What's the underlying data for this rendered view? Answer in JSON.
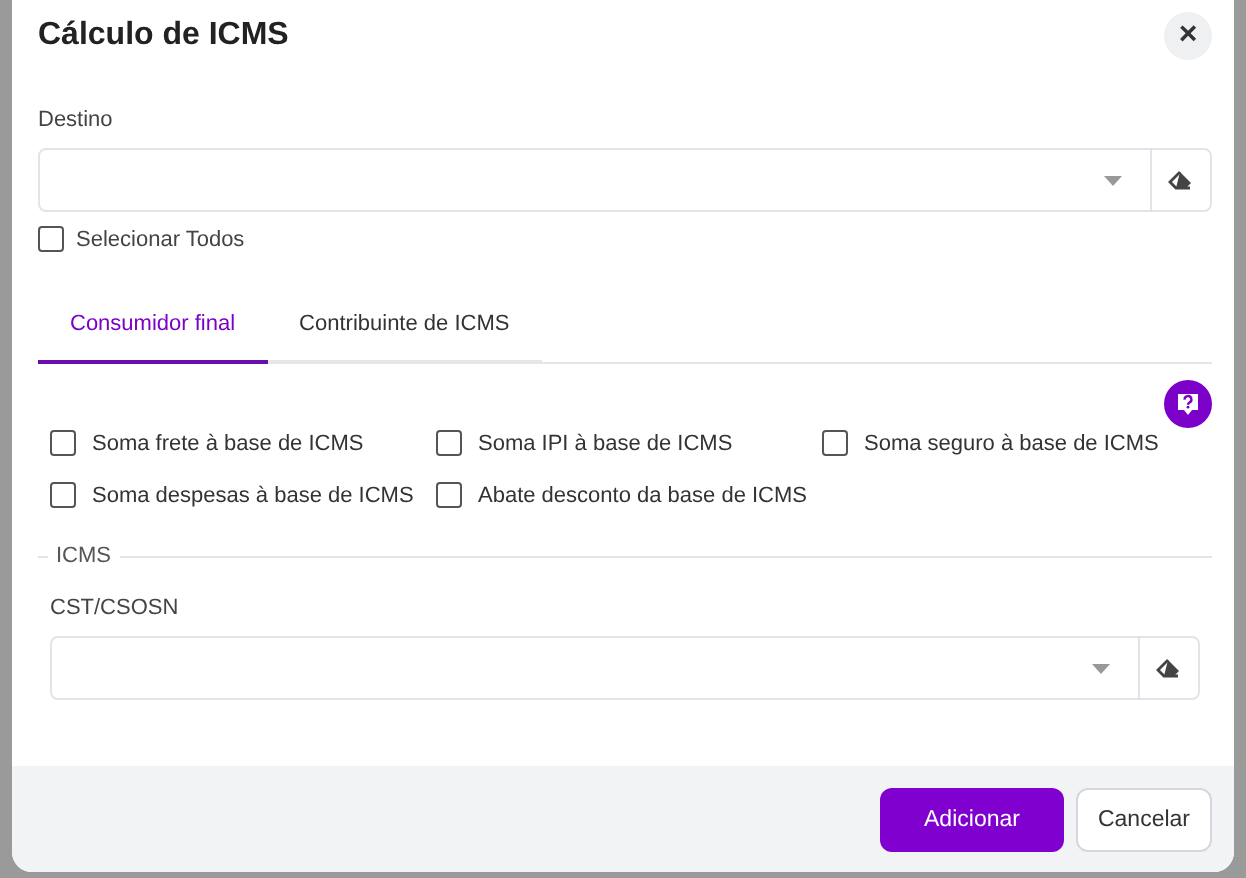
{
  "dialog": {
    "title": "Cálculo de ICMS",
    "close_label": "×"
  },
  "destino": {
    "label": "Destino"
  },
  "select_all": {
    "label": "Selecionar Todos",
    "checked": false
  },
  "tabs": [
    {
      "label": "Consumidor final",
      "selected": true
    },
    {
      "label": "Contribuinte de ICMS",
      "selected": false
    }
  ],
  "options": [
    {
      "label": "Soma frete à base de ICMS",
      "checked": false
    },
    {
      "label": "Soma IPI à base de ICMS",
      "checked": false
    },
    {
      "label": "Soma seguro à base de ICMS",
      "checked": false
    },
    {
      "label": "Soma despesas à base de ICMS",
      "checked": false
    },
    {
      "label": "Abate desconto da base de ICMS",
      "checked": false
    }
  ],
  "icms_section": {
    "title": "ICMS",
    "field_label": "CST/CSOSN"
  },
  "buttons": [
    {
      "label": "Adicionar",
      "kind": "primary"
    },
    {
      "label": "Cancelar",
      "kind": "secondary"
    }
  ]
}
